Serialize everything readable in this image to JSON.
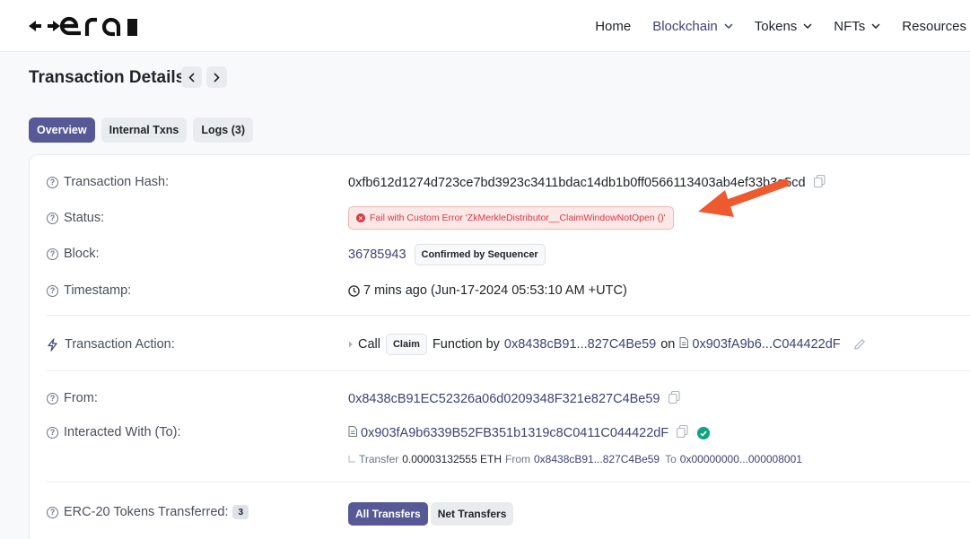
{
  "nav": {
    "items": [
      {
        "label": "Home",
        "dropdown": false
      },
      {
        "label": "Blockchain",
        "dropdown": true
      },
      {
        "label": "Tokens",
        "dropdown": true
      },
      {
        "label": "NFTs",
        "dropdown": true
      },
      {
        "label": "Resources",
        "dropdown": false
      }
    ]
  },
  "page": {
    "title": "Transaction Details"
  },
  "tabs": [
    "Overview",
    "Internal Txns",
    "Logs (3)"
  ],
  "details": {
    "hash": {
      "label": "Transaction Hash:",
      "value": "0xfb612d1274d723ce7bd3923c3411bdac14db1b0ff0566113403ab4ef33b3a5cd"
    },
    "status": {
      "label": "Status:",
      "prefix": "Fail with Custom Error",
      "error": "'ZkMerkleDistributor__ClaimWindowNotOpen ()'"
    },
    "block": {
      "label": "Block:",
      "value": "36785943",
      "badge": "Confirmed by Sequencer"
    },
    "timestamp": {
      "label": "Timestamp:",
      "value": "7 mins ago (Jun-17-2024 05:53:10 AM +UTC)"
    },
    "action": {
      "label": "Transaction Action:",
      "call": "Call",
      "method": "Claim",
      "function_by": "Function by",
      "from": "0x8438cB91...827C4Be59",
      "on": "on",
      "contract": "0x903fA9b6...C044422dF"
    },
    "from": {
      "label": "From:",
      "value": "0x8438cB91EC52326a06d0209348F321e827C4Be59"
    },
    "to": {
      "label": "Interacted With (To):",
      "value": "0x903fA9b6339B52FB351b1319c8C0411C044422dF"
    },
    "transfer": {
      "label": "Transfer",
      "amount": "0.00003132555 ETH",
      "from_label": "From",
      "from": "0x8438cB91...827C4Be59",
      "to_label": "To",
      "to": "0x00000000...000008001"
    },
    "erc20": {
      "label": "ERC-20 Tokens Transferred:",
      "count": "3",
      "buttons": [
        "All Transfers",
        "Net Transfers"
      ]
    }
  },
  "colors": {
    "accent": "#565996",
    "link": "#3d4373",
    "error": "#dc3545",
    "arrow": "#ee5a2f",
    "success": "#10a37f"
  }
}
